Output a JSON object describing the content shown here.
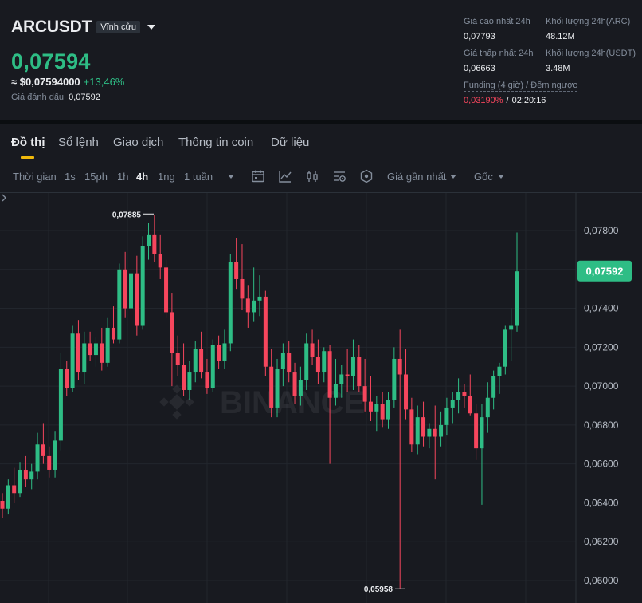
{
  "header": {
    "symbol": "ARCUSDT",
    "contract_type": "Vĩnh cửu",
    "last_price": "0,07594",
    "usd_price": "≈ $0,07594000",
    "change_pct": "+13,46%",
    "mark_price_label": "Giá đánh dấu",
    "mark_price": "0,07592",
    "stats": {
      "high_label": "Giá cao nhất 24h",
      "high": "0,07793",
      "vol_base_label": "Khối lượng 24h(ARC)",
      "vol_base": "48.12M",
      "low_label": "Giá thấp nhất 24h",
      "low": "0,06663",
      "vol_quote_label": "Khối lượng 24h(USDT)",
      "vol_quote": "3.48M"
    },
    "funding_label": "Funding (4 giờ) / Đếm ngược",
    "funding_rate": "0,03190%",
    "funding_sep": "/",
    "countdown": "02:20:16"
  },
  "tabs": [
    "Đồ thị",
    "Sổ lệnh",
    "Giao dịch",
    "Thông tin coin",
    "Dữ liệu"
  ],
  "toolbar": {
    "time_label": "Thời gian",
    "intervals": [
      "1s",
      "15ph",
      "1h",
      "4h",
      "1ng",
      "1 tuần"
    ],
    "active_interval": "4h",
    "price_type": "Giá gần nhất",
    "chart_mode": "Gốc",
    "icons": [
      "calendar-icon",
      "indicator-icon",
      "candle-type-icon",
      "settings-icon",
      "depth-icon"
    ]
  },
  "colors": {
    "up": "#2ebd85",
    "down": "#f6465d",
    "accent": "#f0b90b",
    "bg": "#181a20"
  },
  "watermark": "BINANCE",
  "chart_data": {
    "type": "candlestick",
    "interval": "4h",
    "y_ticks": [
      "0,07800",
      "0,07600",
      "0,07400",
      "0,07200",
      "0,07000",
      "0,06800",
      "0,06600",
      "0,06400",
      "0,06200",
      "0,06000"
    ],
    "ylim": [
      0.0594,
      0.079
    ],
    "current_price_tag": "0,07592",
    "current_price": 0.07592,
    "high_annotation": "0,07885",
    "low_annotation": "0,05958",
    "candles": [
      [
        0.0641,
        0.0645,
        0.0632,
        0.0637
      ],
      [
        0.0637,
        0.0652,
        0.0634,
        0.0649
      ],
      [
        0.0649,
        0.0658,
        0.064,
        0.0645
      ],
      [
        0.0645,
        0.0661,
        0.0643,
        0.0657
      ],
      [
        0.0657,
        0.0664,
        0.0648,
        0.0652
      ],
      [
        0.0652,
        0.066,
        0.0647,
        0.0656
      ],
      [
        0.0656,
        0.0676,
        0.0652,
        0.067
      ],
      [
        0.067,
        0.0681,
        0.066,
        0.0664
      ],
      [
        0.0664,
        0.0669,
        0.0653,
        0.0657
      ],
      [
        0.0657,
        0.0677,
        0.0653,
        0.0672
      ],
      [
        0.0672,
        0.0717,
        0.0667,
        0.0709
      ],
      [
        0.0709,
        0.0713,
        0.0695,
        0.0699
      ],
      [
        0.0699,
        0.0731,
        0.0697,
        0.0727
      ],
      [
        0.0727,
        0.0734,
        0.0703,
        0.0707
      ],
      [
        0.0707,
        0.0728,
        0.0701,
        0.0722
      ],
      [
        0.0722,
        0.0728,
        0.0713,
        0.0716
      ],
      [
        0.0716,
        0.0725,
        0.071,
        0.0722
      ],
      [
        0.0722,
        0.073,
        0.0708,
        0.0712
      ],
      [
        0.0712,
        0.0735,
        0.071,
        0.073
      ],
      [
        0.073,
        0.0741,
        0.0722,
        0.0724
      ],
      [
        0.0724,
        0.0763,
        0.0722,
        0.076
      ],
      [
        0.076,
        0.0769,
        0.0735,
        0.074
      ],
      [
        0.074,
        0.0764,
        0.073,
        0.0758
      ],
      [
        0.0758,
        0.0767,
        0.0726,
        0.0731
      ],
      [
        0.0731,
        0.0777,
        0.0729,
        0.0772
      ],
      [
        0.0772,
        0.0784,
        0.0765,
        0.0778
      ],
      [
        0.0778,
        0.0788,
        0.0764,
        0.0768
      ],
      [
        0.0768,
        0.0778,
        0.0755,
        0.0761
      ],
      [
        0.0761,
        0.0765,
        0.0735,
        0.0738
      ],
      [
        0.0738,
        0.0748,
        0.07,
        0.0717
      ],
      [
        0.0717,
        0.0726,
        0.0705,
        0.0711
      ],
      [
        0.0711,
        0.0722,
        0.0695,
        0.0698
      ],
      [
        0.0698,
        0.0713,
        0.0693,
        0.0707
      ],
      [
        0.0707,
        0.0723,
        0.0702,
        0.0719
      ],
      [
        0.0719,
        0.0728,
        0.0704,
        0.0707
      ],
      [
        0.0707,
        0.0714,
        0.0696,
        0.0699
      ],
      [
        0.0699,
        0.0724,
        0.0697,
        0.0721
      ],
      [
        0.0721,
        0.0726,
        0.0709,
        0.0713
      ],
      [
        0.0713,
        0.0729,
        0.0709,
        0.0722
      ],
      [
        0.0722,
        0.0768,
        0.0718,
        0.0764
      ],
      [
        0.0764,
        0.0776,
        0.075,
        0.0755
      ],
      [
        0.0755,
        0.0773,
        0.0739,
        0.0745
      ],
      [
        0.0745,
        0.0752,
        0.073,
        0.0738
      ],
      [
        0.0738,
        0.0761,
        0.0733,
        0.0744
      ],
      [
        0.0744,
        0.0757,
        0.0736,
        0.0746
      ],
      [
        0.0746,
        0.0749,
        0.0705,
        0.071
      ],
      [
        0.071,
        0.0719,
        0.0684,
        0.0689
      ],
      [
        0.0689,
        0.0714,
        0.0684,
        0.0709
      ],
      [
        0.0709,
        0.0722,
        0.07,
        0.0717
      ],
      [
        0.0717,
        0.0723,
        0.0702,
        0.0707
      ],
      [
        0.0707,
        0.0712,
        0.0691,
        0.0695
      ],
      [
        0.0695,
        0.071,
        0.069,
        0.0703
      ],
      [
        0.0703,
        0.0727,
        0.0698,
        0.0722
      ],
      [
        0.0722,
        0.0729,
        0.0711,
        0.0715
      ],
      [
        0.0715,
        0.0724,
        0.0701,
        0.0707
      ],
      [
        0.0707,
        0.072,
        0.0702,
        0.0718
      ],
      [
        0.0718,
        0.0721,
        0.066,
        0.0694
      ],
      [
        0.0694,
        0.0714,
        0.069,
        0.0701
      ],
      [
        0.0701,
        0.0711,
        0.0694,
        0.0706
      ],
      [
        0.0706,
        0.0719,
        0.0697,
        0.0705
      ],
      [
        0.0705,
        0.0724,
        0.0698,
        0.0715
      ],
      [
        0.0715,
        0.0721,
        0.0697,
        0.07
      ],
      [
        0.07,
        0.0714,
        0.0687,
        0.0692
      ],
      [
        0.0692,
        0.0705,
        0.0682,
        0.0687
      ],
      [
        0.0687,
        0.0695,
        0.0677,
        0.0691
      ],
      [
        0.0691,
        0.0697,
        0.0679,
        0.0683
      ],
      [
        0.0683,
        0.0697,
        0.0678,
        0.0693
      ],
      [
        0.0693,
        0.072,
        0.0689,
        0.0714
      ],
      [
        0.0714,
        0.0729,
        0.0596,
        0.0706
      ],
      [
        0.0706,
        0.0719,
        0.0683,
        0.0688
      ],
      [
        0.0688,
        0.0694,
        0.0666,
        0.067
      ],
      [
        0.067,
        0.069,
        0.0665,
        0.0684
      ],
      [
        0.0684,
        0.0692,
        0.0669,
        0.0674
      ],
      [
        0.0674,
        0.0681,
        0.0668,
        0.0678
      ],
      [
        0.0678,
        0.069,
        0.0652,
        0.0674
      ],
      [
        0.0674,
        0.0687,
        0.0669,
        0.068
      ],
      [
        0.068,
        0.0694,
        0.0675,
        0.0689
      ],
      [
        0.0689,
        0.0697,
        0.0681,
        0.0693
      ],
      [
        0.0693,
        0.0704,
        0.0686,
        0.0697
      ],
      [
        0.0697,
        0.0701,
        0.0689,
        0.0695
      ],
      [
        0.0695,
        0.0706,
        0.0685,
        0.0686
      ],
      [
        0.0686,
        0.0691,
        0.0662,
        0.0668
      ],
      [
        0.0668,
        0.0691,
        0.0639,
        0.0684
      ],
      [
        0.0684,
        0.0702,
        0.0676,
        0.0694
      ],
      [
        0.0694,
        0.0708,
        0.0688,
        0.0705
      ],
      [
        0.0705,
        0.0712,
        0.0696,
        0.071
      ],
      [
        0.071,
        0.0731,
        0.0706,
        0.0729
      ],
      [
        0.0729,
        0.074,
        0.0713,
        0.0731
      ],
      [
        0.0731,
        0.0779,
        0.0728,
        0.0759
      ]
    ]
  }
}
